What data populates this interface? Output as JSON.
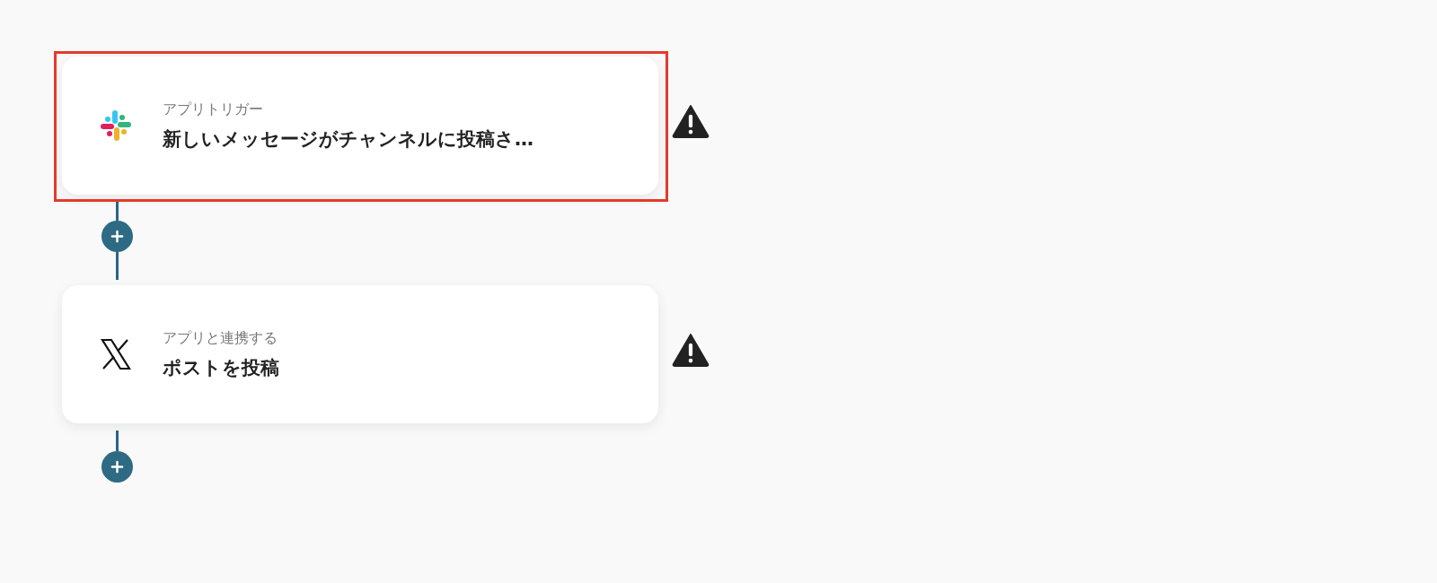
{
  "steps": [
    {
      "kind": "slack",
      "label": "アプリトリガー",
      "title": "新しいメッセージがチャンネルに投稿さ…",
      "selected": true,
      "warning": true
    },
    {
      "kind": "x",
      "label": "アプリと連携する",
      "title": "ポストを投稿",
      "selected": false,
      "warning": true
    }
  ]
}
